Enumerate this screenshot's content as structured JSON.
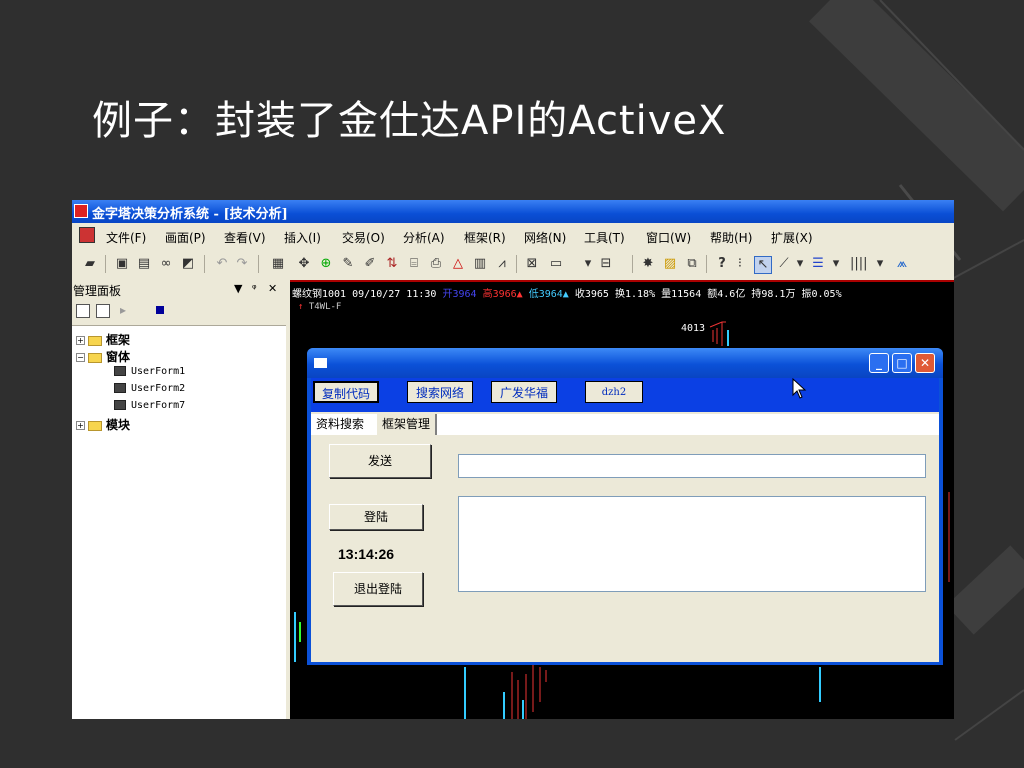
{
  "slide": {
    "title": "例子：封装了金仕达API的ActiveX"
  },
  "app": {
    "title": "金字塔决策分析系统 - [技术分析]",
    "menu": [
      "文件(F)",
      "画面(P)",
      "查看(V)",
      "插入(I)",
      "交易(O)",
      "分析(A)",
      "框架(R)",
      "网络(N)",
      "工具(T)",
      "窗口(W)",
      "帮助(H)",
      "扩展(X)"
    ],
    "toolbar_icons": [
      "open-folder-icon",
      "strategy-icon",
      "layout-icon",
      "binoculars-icon",
      "chart-mode-icon",
      "undo-icon",
      "redo-icon",
      "tile-icon",
      "move-icon",
      "zoom-icon",
      "pencil-icon",
      "edit-icon",
      "sort-icon",
      "filter-icon",
      "export-icon",
      "triangle-icon",
      "formula-icon",
      "indicator-icon",
      "chart-icon",
      "window-icon",
      "palette-icon",
      "notes-icon",
      "copy-icon",
      "help-icon",
      "pointer-icon",
      "line-icon",
      "text-icon",
      "bars-icon",
      "fan-icon"
    ]
  },
  "panel": {
    "title": "管理面板",
    "tree": [
      {
        "label": "框架",
        "expanded": false
      },
      {
        "label": "窗体",
        "expanded": true,
        "children": [
          "UserForm1",
          "UserForm2",
          "UserForm7"
        ]
      },
      {
        "label": "模块",
        "expanded": false
      }
    ]
  },
  "chart": {
    "quote": {
      "symbol": "螺纹钢1001",
      "datetime": "09/10/27 11:30",
      "open": "开3964",
      "high": "高3966▲",
      "low": "低3964▲",
      "close": "收3965",
      "turnover": "换1.18%",
      "volume": "量11564",
      "amount": "额4.6亿",
      "hold": "持98.1万",
      "amplitude": "振0.05%"
    },
    "sub": "T4WL-F",
    "price_label": "4013"
  },
  "dialog": {
    "buttons": [
      "复制代码",
      "搜索网络",
      "广发华福",
      "dzh2"
    ],
    "tabs": [
      "资料搜索",
      "框架管理"
    ],
    "send_label": "发送",
    "login_label": "登陆",
    "logout_label": "退出登陆",
    "time": "13:14:26",
    "input_value": "",
    "output_value": ""
  }
}
